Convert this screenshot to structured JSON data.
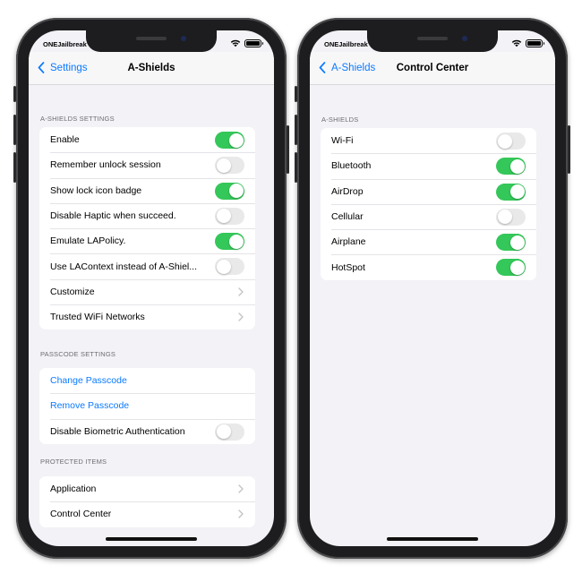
{
  "left": {
    "status": {
      "carrier": "ONEJailbreak"
    },
    "nav": {
      "back": "Settings",
      "title": "A-Shields"
    },
    "sections": [
      {
        "header": "A-SHIELDS SETTINGS",
        "rows": [
          {
            "label": "Enable",
            "type": "toggle",
            "on": true
          },
          {
            "label": "Remember unlock session",
            "type": "toggle",
            "on": false
          },
          {
            "label": "Show lock icon badge",
            "type": "toggle",
            "on": true
          },
          {
            "label": "Disable Haptic when succeed.",
            "type": "toggle",
            "on": false
          },
          {
            "label": "Emulate LAPolicy.",
            "type": "toggle",
            "on": true
          },
          {
            "label": "Use LAContext instead of A-Shiel...",
            "type": "toggle",
            "on": false
          },
          {
            "label": "Customize",
            "type": "chevron"
          },
          {
            "label": "Trusted WiFi Networks",
            "type": "chevron"
          }
        ]
      },
      {
        "header": "PASSCODE SETTINGS",
        "rows": [
          {
            "label": "Change Passcode",
            "type": "link"
          },
          {
            "label": "Remove Passcode",
            "type": "link"
          },
          {
            "label": "Disable Biometric Authentication",
            "type": "toggle",
            "on": false
          }
        ]
      },
      {
        "header": "PROTECTED ITEMS",
        "rows": [
          {
            "label": "Application",
            "type": "chevron"
          },
          {
            "label": "Control Center",
            "type": "chevron"
          }
        ]
      }
    ]
  },
  "right": {
    "status": {
      "carrier": "ONEJailbreak"
    },
    "nav": {
      "back": "A-Shields",
      "title": "Control Center"
    },
    "sections": [
      {
        "header": "A-SHIELDS",
        "rows": [
          {
            "label": "Wi-Fi",
            "type": "toggle",
            "on": false
          },
          {
            "label": "Bluetooth",
            "type": "toggle",
            "on": true
          },
          {
            "label": "AirDrop",
            "type": "toggle",
            "on": true
          },
          {
            "label": "Cellular",
            "type": "toggle",
            "on": false
          },
          {
            "label": "Airplane",
            "type": "toggle",
            "on": true
          },
          {
            "label": "HotSpot",
            "type": "toggle",
            "on": true
          }
        ]
      }
    ]
  },
  "colors": {
    "accent": "#0a7aff",
    "toggle_on": "#34c759",
    "toggle_off": "#e9e9ea",
    "background": "#f2f2f7"
  },
  "icons": [
    "back-chevron-icon",
    "chevron-right-icon",
    "wifi-icon",
    "battery-icon"
  ]
}
